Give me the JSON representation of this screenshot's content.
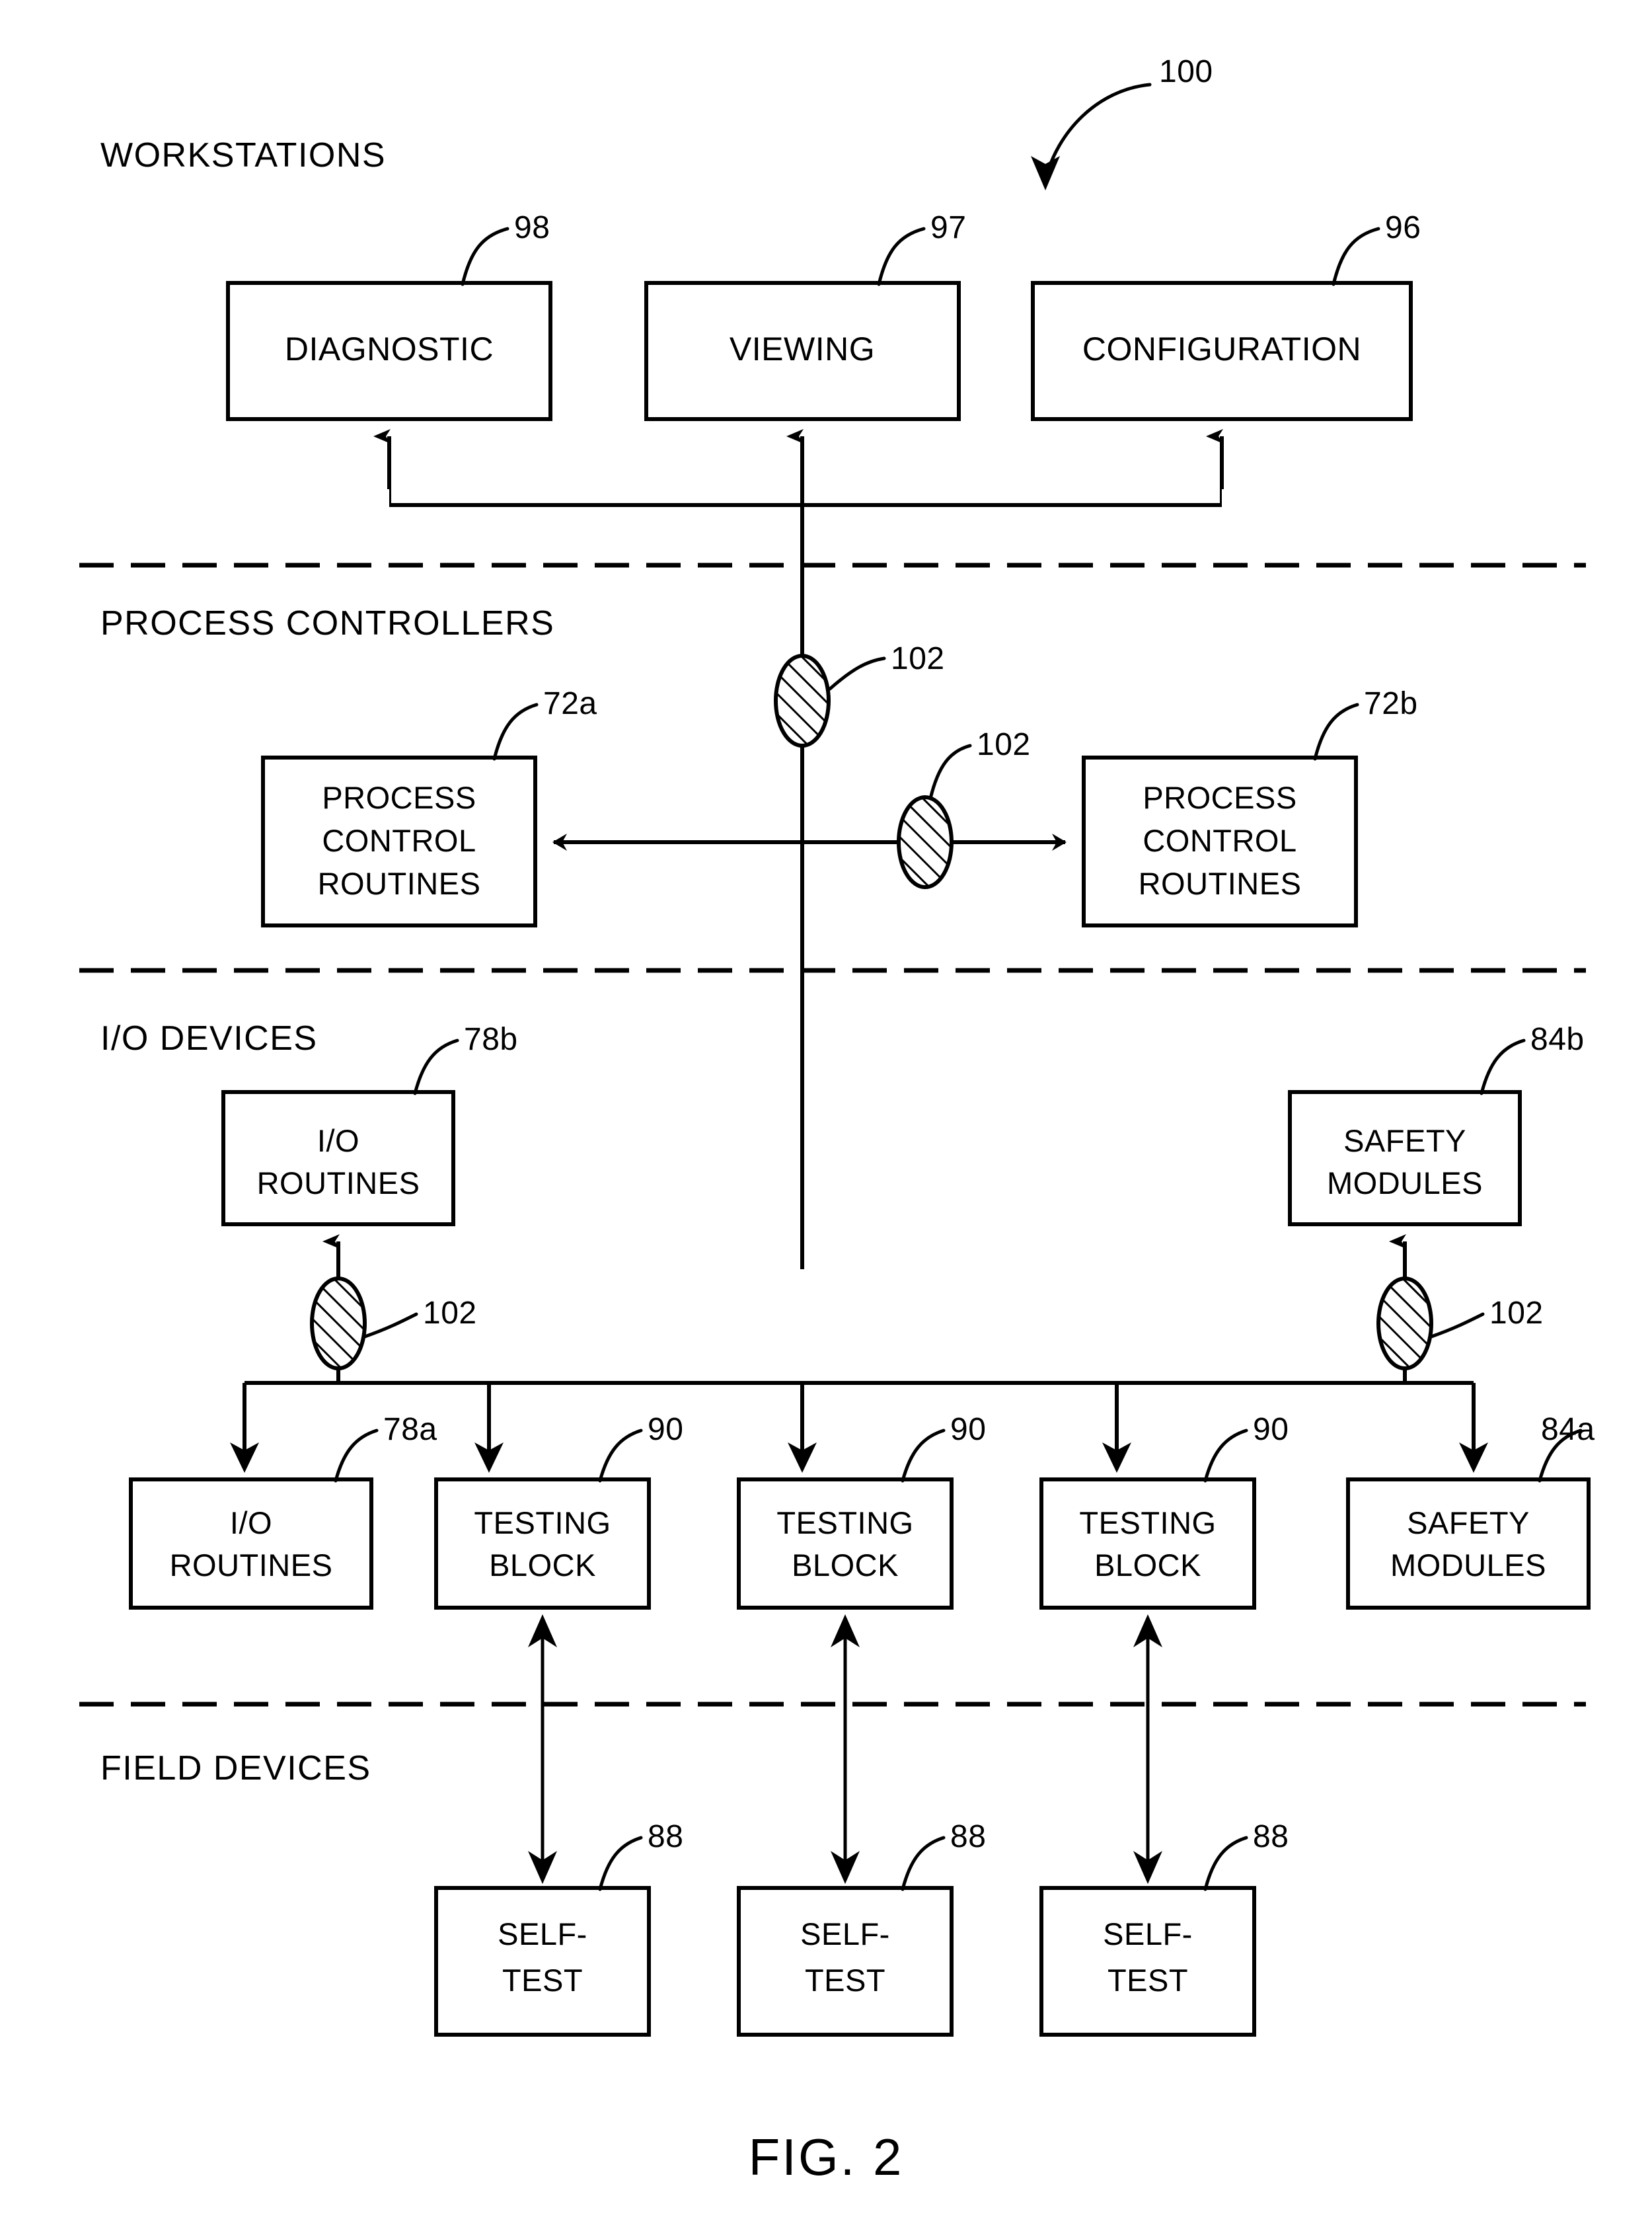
{
  "figure": {
    "caption": "FIG. 2",
    "system_ref": "100"
  },
  "sections": [
    {
      "id": "workstations",
      "label": "WORKSTATIONS"
    },
    {
      "id": "process-controllers",
      "label": "PROCESS CONTROLLERS"
    },
    {
      "id": "io-devices",
      "label": "I/O DEVICES"
    },
    {
      "id": "field-devices",
      "label": "FIELD DEVICES"
    }
  ],
  "workstations": [
    {
      "id": "diagnostic",
      "label": "DIAGNOSTIC",
      "ref": "98"
    },
    {
      "id": "viewing",
      "label": "VIEWING",
      "ref": "97"
    },
    {
      "id": "configuration",
      "label": "CONFIGURATION",
      "ref": "96"
    }
  ],
  "process_controllers": [
    {
      "id": "pcr-left",
      "line1": "PROCESS",
      "line2": "CONTROL",
      "line3": "ROUTINES",
      "ref": "72a"
    },
    {
      "id": "pcr-right",
      "line1": "PROCESS",
      "line2": "CONTROL",
      "line3": "ROUTINES",
      "ref": "72b"
    }
  ],
  "io_devices_upper": [
    {
      "id": "io-routines-b",
      "line1": "I/O",
      "line2": "ROUTINES",
      "ref": "78b"
    },
    {
      "id": "safety-modules-b",
      "line1": "SAFETY",
      "line2": "MODULES",
      "ref": "84b"
    }
  ],
  "io_devices_row": [
    {
      "id": "io-routines-a",
      "line1": "I/O",
      "line2": "ROUTINES",
      "ref": "78a"
    },
    {
      "id": "testing-block-1",
      "line1": "TESTING",
      "line2": "BLOCK",
      "ref": "90"
    },
    {
      "id": "testing-block-2",
      "line1": "TESTING",
      "line2": "BLOCK",
      "ref": "90"
    },
    {
      "id": "testing-block-3",
      "line1": "TESTING",
      "line2": "BLOCK",
      "ref": "90"
    },
    {
      "id": "safety-modules-a",
      "line1": "SAFETY",
      "line2": "MODULES",
      "ref": "84a"
    }
  ],
  "field_devices": [
    {
      "id": "self-test-1",
      "line1": "SELF-",
      "line2": "TEST",
      "ref": "88"
    },
    {
      "id": "self-test-2",
      "line1": "SELF-",
      "line2": "TEST",
      "ref": "88"
    },
    {
      "id": "self-test-3",
      "line1": "SELF-",
      "line2": "TEST",
      "ref": "88"
    }
  ],
  "connector_nodes": [
    {
      "id": "node-bus-top",
      "ref": "102"
    },
    {
      "id": "node-controller-link",
      "ref": "102"
    },
    {
      "id": "node-io-left",
      "ref": "102"
    },
    {
      "id": "node-io-right",
      "ref": "102"
    }
  ],
  "colors": {
    "ink": "#000000",
    "paper": "#ffffff"
  }
}
